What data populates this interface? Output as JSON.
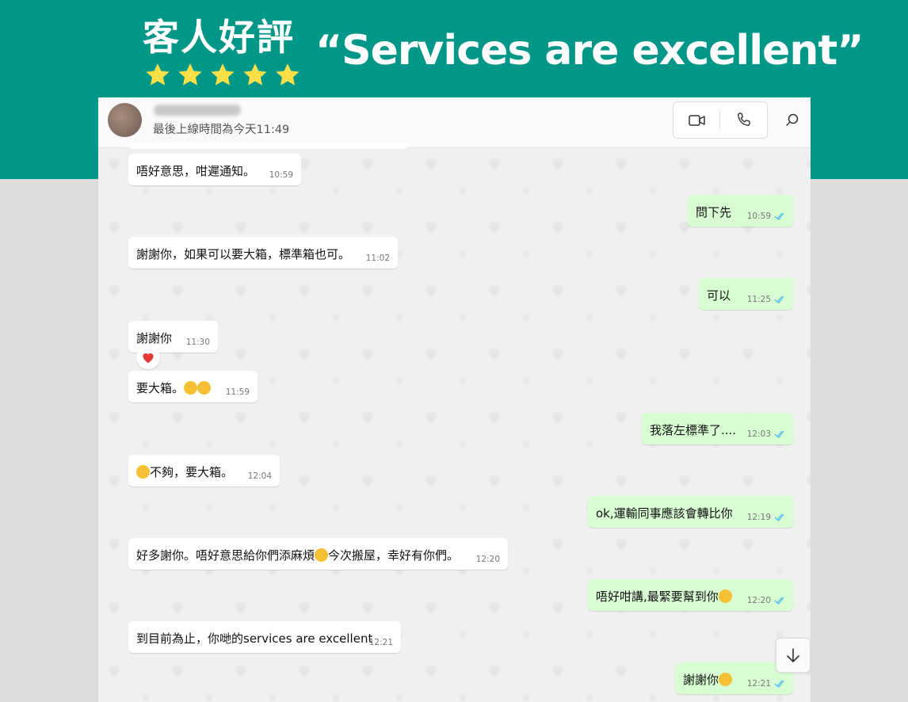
{
  "banner": {
    "badge_title": "客人好評",
    "star_count": 5,
    "quote": "“Services are excellent”",
    "bg_color": "#009688",
    "star_color": "#fde047"
  },
  "chat": {
    "header": {
      "last_seen": "最後上線時間為今天11:49",
      "icons": [
        "video-call-icon",
        "phone-call-icon",
        "search-icon"
      ]
    },
    "messages": [
      {
        "dir": "in",
        "text": "唔好意思，咁遲通知。",
        "time": "10:59"
      },
      {
        "dir": "out",
        "text": "問下先",
        "time": "10:59"
      },
      {
        "dir": "in",
        "text": "謝謝你，如果可以要大箱，標準箱也可。",
        "time": "11:02"
      },
      {
        "dir": "out",
        "text": "可以",
        "time": "11:25"
      },
      {
        "dir": "in",
        "text": "謝謝你",
        "time": "11:30",
        "reaction": "heart"
      },
      {
        "dir": "in",
        "text": "要大箱。",
        "time": "11:59"
      },
      {
        "dir": "out",
        "text": "我落左標準了....",
        "time": "12:03"
      },
      {
        "dir": "in",
        "text": "不夠，要大箱。",
        "time": "12:04"
      },
      {
        "dir": "out",
        "text": "ok,運輸同事應該會轉比你",
        "time": "12:19"
      },
      {
        "dir": "in",
        "text_a": "好多謝你。唔好意思給你們添麻煩",
        "text_b": "今次搬屋，幸好有你們。",
        "time": "12:20"
      },
      {
        "dir": "out",
        "text": "唔好咁講,最緊要幫到你",
        "time": "12:20"
      },
      {
        "dir": "in",
        "text": "到目前為止，你哋的services are excellent",
        "time": "12:21"
      },
      {
        "dir": "out",
        "text": "謝謝你",
        "time": "12:21"
      }
    ]
  }
}
